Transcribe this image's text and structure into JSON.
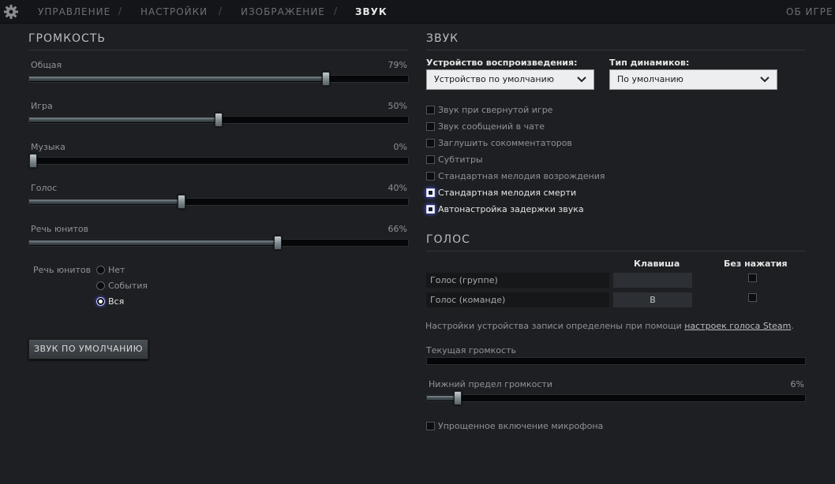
{
  "nav": {
    "tabs": [
      {
        "label": "УПРАВЛЕНИЕ",
        "active": false
      },
      {
        "label": "НАСТРОЙКИ",
        "active": false
      },
      {
        "label": "ИЗОБРАЖЕНИЕ",
        "active": false
      },
      {
        "label": "ЗВУК",
        "active": true
      }
    ],
    "separator": "/",
    "about_label": "ОБ ИГРЕ",
    "settings_icon": "gear-icon"
  },
  "volume": {
    "title": "ГРОМКОСТЬ",
    "sliders": [
      {
        "label": "Общая",
        "value": 79,
        "display": "79%"
      },
      {
        "label": "Игра",
        "value": 50,
        "display": "50%"
      },
      {
        "label": "Музыка",
        "value": 0,
        "display": "0%"
      },
      {
        "label": "Голос",
        "value": 40,
        "display": "40%"
      },
      {
        "label": "Речь юнитов",
        "value": 66,
        "display": "66%"
      }
    ],
    "unit_speech": {
      "label": "Речь юнитов",
      "options": [
        "Нет",
        "События",
        "Вся"
      ],
      "selected": "Вся"
    },
    "default_button": "ЗВУК ПО УМОЛЧАНИЮ"
  },
  "sound": {
    "title": "ЗВУК",
    "device_label": "Устройство воспроизведения:",
    "device_value": "Устройство по умолчанию",
    "speaker_label": "Тип динамиков:",
    "speaker_value": "По умолчанию",
    "options": [
      {
        "label": "Звук при свернутой игре",
        "checked": false
      },
      {
        "label": "Звук сообщений в чате",
        "checked": false
      },
      {
        "label": "Заглушить сокомментаторов",
        "checked": false
      },
      {
        "label": "Субтитры",
        "checked": false
      },
      {
        "label": "Стандартная мелодия возрождения",
        "checked": false
      },
      {
        "label": "Стандартная мелодия смерти",
        "checked": true
      },
      {
        "label": "Автонастройка задержки звука",
        "checked": true
      }
    ]
  },
  "voice": {
    "title": "ГОЛОС",
    "col_key": "Клавиша",
    "col_no_press": "Без нажатия",
    "rows": [
      {
        "label": "Голос (группе)",
        "key": "",
        "no_press": false
      },
      {
        "label": "Голос (команде)",
        "key": "B",
        "no_press": false
      }
    ],
    "record_text": "Настройки устройства записи определены при помощи ",
    "record_link": "настроек голоса Steam",
    "record_end": ".",
    "current_volume_label": "Текущая громкость",
    "threshold_label": "Нижний предел громкости",
    "threshold_value": 6,
    "threshold_display": "6%",
    "simplified_mic_label": "Упрощенное включение микрофона",
    "simplified_mic_checked": false
  },
  "colors": {
    "background": "#1d1f22",
    "topbar": "#141518",
    "accent_glow": "#5a5cff"
  }
}
